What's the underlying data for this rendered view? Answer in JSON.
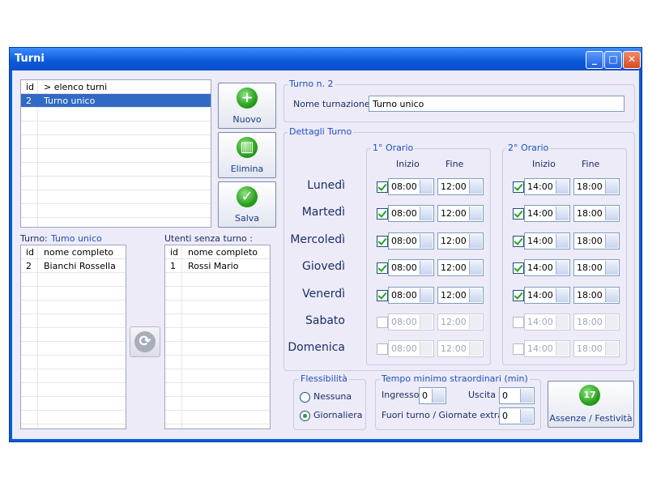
{
  "window": {
    "title": "Turni"
  },
  "shifts_list": {
    "headers": [
      "id",
      "> elenco turni"
    ],
    "rows": [
      {
        "id": "2",
        "name": "Turno unico"
      }
    ]
  },
  "buttons": {
    "new": "Nuovo",
    "delete": "Elimina",
    "save": "Salva",
    "absences": "Assenze / Festività",
    "absences_badge": "17"
  },
  "assigned": {
    "label": "Turno:",
    "value": "Tumo unico",
    "headers": [
      "id",
      "nome completo"
    ],
    "rows": [
      {
        "id": "2",
        "name": "Bianchi Rossella"
      }
    ]
  },
  "unassigned": {
    "label": "Utenti senza turno :",
    "headers": [
      "id",
      "nome completo"
    ],
    "rows": [
      {
        "id": "1",
        "name": "Rossi Mario"
      }
    ]
  },
  "turno": {
    "group_label": "Turno n. 2",
    "name_label": "Nome turnazione",
    "name_value": "Turno unico"
  },
  "details": {
    "group_label": "Dettagli Turno",
    "first_label": "1° Orario",
    "second_label": "2° Orario",
    "start_label": "Inizio",
    "end_label": "Fine",
    "days": [
      {
        "name": "Lunedì",
        "s1_on": true,
        "s1_start": "08:00",
        "s1_end": "12:00",
        "s2_on": true,
        "s2_start": "14:00",
        "s2_end": "18:00"
      },
      {
        "name": "Martedì",
        "s1_on": true,
        "s1_start": "08:00",
        "s1_end": "12:00",
        "s2_on": true,
        "s2_start": "14:00",
        "s2_end": "18:00"
      },
      {
        "name": "Mercoledì",
        "s1_on": true,
        "s1_start": "08:00",
        "s1_end": "12:00",
        "s2_on": true,
        "s2_start": "14:00",
        "s2_end": "18:00"
      },
      {
        "name": "Giovedì",
        "s1_on": true,
        "s1_start": "08:00",
        "s1_end": "12:00",
        "s2_on": true,
        "s2_start": "14:00",
        "s2_end": "18:00"
      },
      {
        "name": "Venerdì",
        "s1_on": true,
        "s1_start": "08:00",
        "s1_end": "12:00",
        "s2_on": true,
        "s2_start": "14:00",
        "s2_end": "18:00"
      },
      {
        "name": "Sabato",
        "s1_on": false,
        "s1_start": "08:00",
        "s1_end": "12:00",
        "s2_on": false,
        "s2_start": "14:00",
        "s2_end": "18:00"
      },
      {
        "name": "Domenica",
        "s1_on": false,
        "s1_start": "08:00",
        "s1_end": "12:00",
        "s2_on": false,
        "s2_start": "14:00",
        "s2_end": "18:00"
      }
    ]
  },
  "flex": {
    "group_label": "Flessibilità",
    "opt_none": "Nessuna",
    "opt_daily": "Giornaliera",
    "selected": "Giornaliera"
  },
  "overtime": {
    "group_label": "Tempo minimo straordinari  (min)",
    "in_label": "Ingresso",
    "in_value": "0",
    "out_label": "Uscita",
    "out_value": "0",
    "extra_label": "Fuori turno  /  Giornate extra",
    "extra_value": "0"
  }
}
